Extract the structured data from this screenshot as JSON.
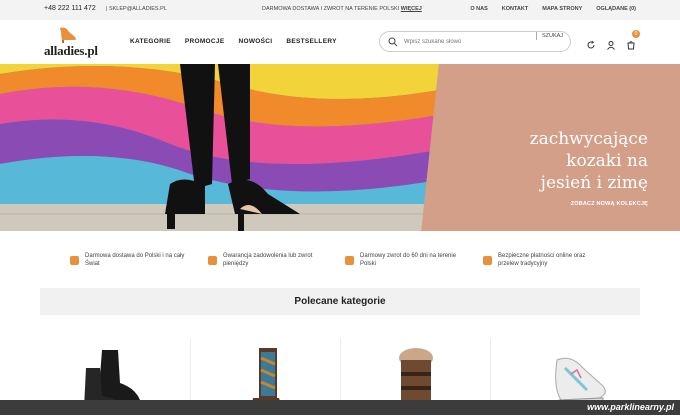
{
  "topbar": {
    "phone": "+48 222 111 472",
    "email": "| SKLEP@ALLADIES.PL",
    "shipping_text": "DARMOWA DOSTAWA I ZWROT NA TERENIE POLSKI",
    "shipping_link": "WIĘCEJ",
    "links": [
      "O NAS",
      "KONTAKT",
      "MAPA STRONY",
      "OGLĄDANE (0)"
    ]
  },
  "header": {
    "logo": "alladies.pl",
    "nav": [
      "KATEGORIE",
      "PROMOCJE",
      "NOWOŚCI",
      "BESTSELLERY"
    ],
    "search": {
      "placeholder": "Wpisz szukane słowo",
      "button": "SZUKAJ"
    },
    "cart_count": "0"
  },
  "hero": {
    "headline_line1": "zachwycające",
    "headline_line2": "kozaki na",
    "headline_line3": "jesień i zimę",
    "cta": "ZOBACZ NOWĄ KOLEKCJĘ"
  },
  "benefits": [
    "Darmowa dostawa do Polski i na cały Świat",
    "Gwarancja zadowolenia lub zwrot pieniędzy",
    "Darmowy zwrot do 60 dni na terenie Polski",
    "Bezpieczne płatności online oraz przelew tradycyjny"
  ],
  "recommended": {
    "title": "Polecane kategorie"
  },
  "watermark": "www.parklinearny.pl",
  "colors": {
    "accent": "#e8913c",
    "hero_panel": "#d49f89"
  },
  "icons": [
    "search-icon",
    "refresh-icon",
    "user-icon",
    "cart-icon"
  ]
}
